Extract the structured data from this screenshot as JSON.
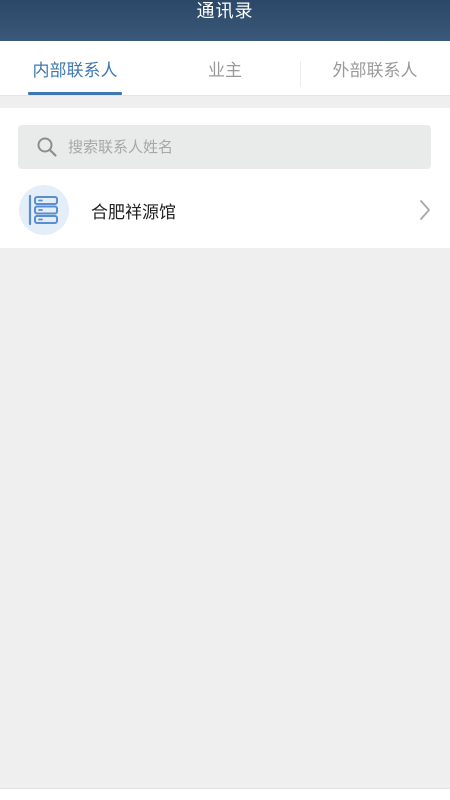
{
  "header": {
    "title": "通讯录"
  },
  "tabs": [
    {
      "label": "内部联系人",
      "active": true
    },
    {
      "label": "业主",
      "active": false
    },
    {
      "label": "外部联系人",
      "active": false
    }
  ],
  "search": {
    "placeholder": "搜索联系人姓名",
    "icon": "search-icon"
  },
  "contacts": [
    {
      "name": "合肥祥源馆",
      "icon": "organization-icon"
    }
  ],
  "bottom_nav": [
    {
      "icon": "document-icon"
    },
    {
      "icon": "contacts-icon",
      "active": true
    },
    {
      "icon": "settings-icon"
    }
  ],
  "colors": {
    "header": "#2c4868",
    "accent": "#3f78b0",
    "background": "#eeefee"
  }
}
